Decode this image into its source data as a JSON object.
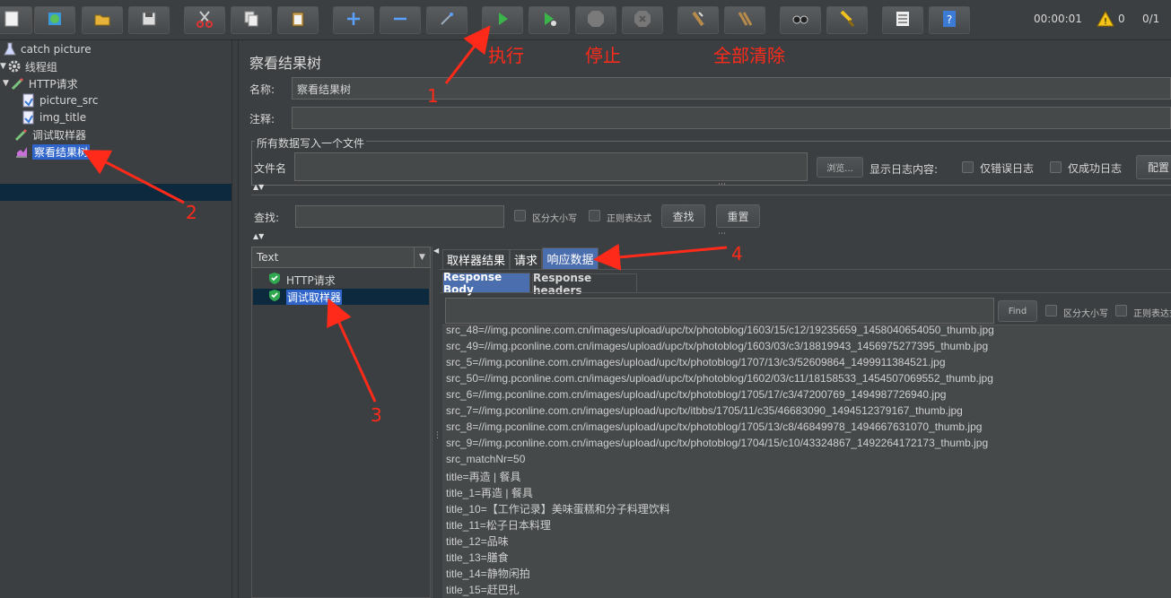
{
  "toolbar": {
    "buttons": [
      {
        "name": "new-icon"
      },
      {
        "name": "templates-icon"
      },
      {
        "name": "open-icon"
      },
      {
        "name": "save-icon"
      },
      {
        "name": "cut-icon"
      },
      {
        "name": "copy-icon"
      },
      {
        "name": "paste-icon"
      },
      {
        "name": "expand-icon"
      },
      {
        "name": "collapse-icon"
      },
      {
        "name": "toggle-icon"
      },
      {
        "name": "start-icon"
      },
      {
        "name": "start-no-pause-icon"
      },
      {
        "name": "stop-icon"
      },
      {
        "name": "shutdown-icon"
      },
      {
        "name": "clear-icon"
      },
      {
        "name": "clear-all-icon"
      },
      {
        "name": "search-icon"
      },
      {
        "name": "reset-search-icon"
      },
      {
        "name": "function-helper-icon"
      },
      {
        "name": "help-icon"
      }
    ],
    "timer": "00:00:01",
    "warning_count": "0",
    "threads": "0/1"
  },
  "tree": {
    "items": [
      {
        "label": "catch picture",
        "icon": "flask-icon"
      },
      {
        "label": "线程组",
        "icon": "gear-icon"
      },
      {
        "label": "HTTP请求",
        "icon": "pipette-icon"
      },
      {
        "label": "picture_src",
        "icon": "extractor-icon"
      },
      {
        "label": "img_title",
        "icon": "extractor-icon"
      },
      {
        "label": "调试取样器",
        "icon": "pipette-icon"
      },
      {
        "label": "察看结果树",
        "icon": "chart-icon"
      }
    ]
  },
  "panel": {
    "title": "察看结果树",
    "name_label": "名称:",
    "name_value": "察看结果树",
    "comment_label": "注释:",
    "comment_value": "",
    "file_group_title": "所有数据写入一个文件",
    "filename_label": "文件名",
    "filename_value": "",
    "browse_label": "浏览...",
    "log_label": "显示日志内容:",
    "errors_only": "仅错误日志",
    "success_only": "仅成功日志",
    "configure": "配置",
    "search_label": "查找:",
    "case_sensitive": "区分大小写",
    "regex": "正则表达式",
    "search_button": "查找",
    "reset_button": "重置"
  },
  "result_tree": {
    "renderer": "Text",
    "items": [
      {
        "label": "HTTP请求",
        "status": "success"
      },
      {
        "label": "调试取样器",
        "status": "success"
      }
    ]
  },
  "tabs": [
    "取样器结果",
    "请求",
    "响应数据"
  ],
  "active_tab": "响应数据",
  "subtabs": [
    "Response Body",
    "Response headers"
  ],
  "active_subtab": "Response Body",
  "response_search": {
    "find_label": "Find",
    "case_sensitive": "区分大小写",
    "regex": "正则表达式"
  },
  "response_lines": [
    "src_48=//img.pconline.com.cn/images/upload/upc/tx/photoblog/1603/15/c12/19235659_1458040654050_thumb.jpg",
    "src_49=//img.pconline.com.cn/images/upload/upc/tx/photoblog/1603/03/c3/18819943_1456975277395_thumb.jpg",
    "src_5=//img.pconline.com.cn/images/upload/upc/tx/photoblog/1707/13/c3/52609864_1499911384521.jpg",
    "src_50=//img.pconline.com.cn/images/upload/upc/tx/photoblog/1602/03/c11/18158533_1454507069552_thumb.jpg",
    "src_6=//img.pconline.com.cn/images/upload/upc/tx/photoblog/1705/17/c3/47200769_1494987726940.jpg",
    "src_7=//img.pconline.com.cn/images/upload/upc/tx/itbbs/1705/11/c35/46683090_1494512379167_thumb.jpg",
    "src_8=//img.pconline.com.cn/images/upload/upc/tx/photoblog/1705/13/c8/46849978_1494667631070_thumb.jpg",
    "src_9=//img.pconline.com.cn/images/upload/upc/tx/photoblog/1704/15/c10/43324867_1492264172173_thumb.jpg",
    "src_matchNr=50",
    "title=再造 | 餐具",
    "title_1=再造 | 餐具",
    "title_10=【工作记录】美味蛋糕和分子料理饮料",
    "title_11=松子日本料理",
    "title_12=品味",
    "title_13=膳食",
    "title_14=静物闲拍",
    "title_15=赶巴扎"
  ],
  "annotations": {
    "run": "执行",
    "stop": "停止",
    "clear_all": "全部清除",
    "n1": "1",
    "n2": "2",
    "n3": "3",
    "n4": "4"
  },
  "colors": {
    "background": "#3c3f41",
    "selection": "#2f65ca",
    "tab_active": "#4b6eaf",
    "annotation": "#ff2a1a"
  }
}
